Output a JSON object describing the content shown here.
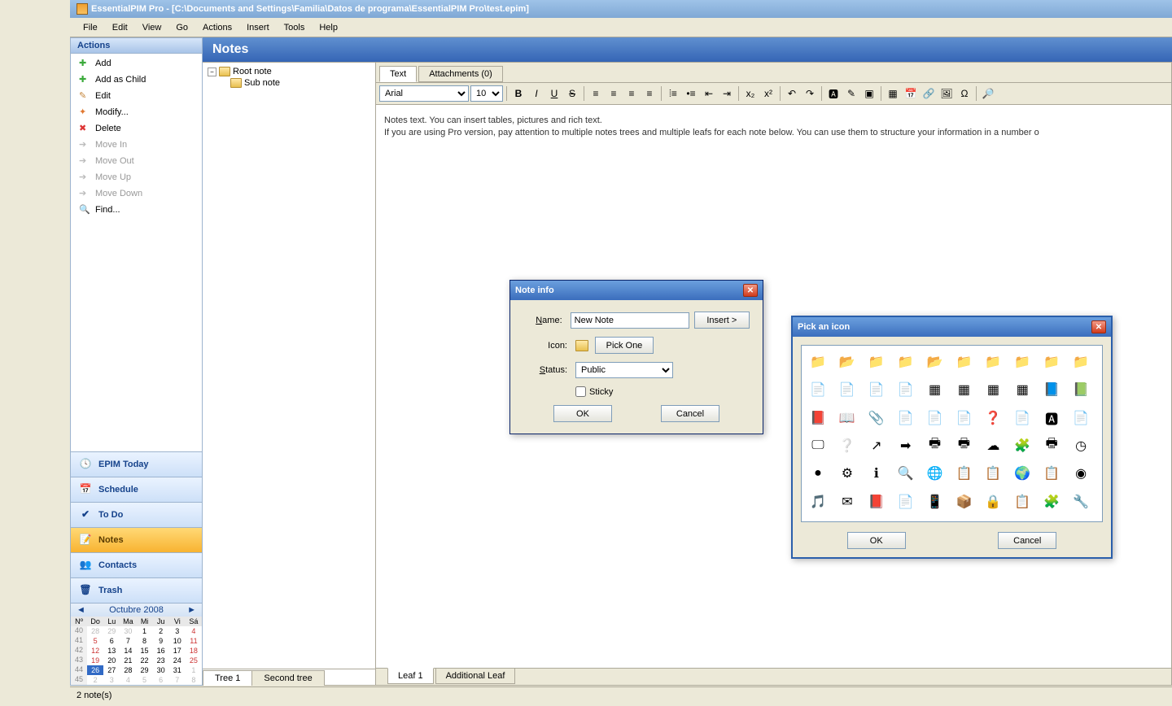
{
  "title": "EssentialPIM Pro - [C:\\Documents and Settings\\Familia\\Datos de programa\\EssentialPIM Pro\\test.epim]",
  "menu": [
    "File",
    "Edit",
    "View",
    "Go",
    "Actions",
    "Insert",
    "Tools",
    "Help"
  ],
  "actions_header": "Actions",
  "actions": [
    {
      "label": "Add",
      "icon": "ic-add-plus",
      "disabled": false
    },
    {
      "label": "Add as Child",
      "icon": "ic-addchild",
      "disabled": false
    },
    {
      "label": "Edit",
      "icon": "ic-edit",
      "disabled": false
    },
    {
      "label": "Modify...",
      "icon": "ic-modify",
      "disabled": false
    },
    {
      "label": "Delete",
      "icon": "ic-delete",
      "disabled": false
    },
    {
      "label": "Move In",
      "icon": "ic-arrow",
      "disabled": true
    },
    {
      "label": "Move Out",
      "icon": "ic-arrow",
      "disabled": true
    },
    {
      "label": "Move Up",
      "icon": "ic-arrow",
      "disabled": true
    },
    {
      "label": "Move Down",
      "icon": "ic-arrow",
      "disabled": true
    },
    {
      "label": "Find...",
      "icon": "ic-find",
      "disabled": false
    }
  ],
  "nav": [
    {
      "label": "EPIM Today",
      "icon": "🕓",
      "active": false
    },
    {
      "label": "Schedule",
      "icon": "📅",
      "active": false
    },
    {
      "label": "To Do",
      "icon": "✔",
      "active": false
    },
    {
      "label": "Notes",
      "icon": "📝",
      "active": true
    },
    {
      "label": "Contacts",
      "icon": "👥",
      "active": false
    },
    {
      "label": "Trash",
      "icon": "🗑",
      "active": false
    }
  ],
  "calendar": {
    "title": "Octubre  2008",
    "days_hdr": [
      "Nº",
      "Do",
      "Lu",
      "Ma",
      "Mi",
      "Ju",
      "Vi",
      "Sá"
    ],
    "rows": [
      [
        "40",
        "28",
        "29",
        "30",
        "1",
        "2",
        "3",
        "4"
      ],
      [
        "41",
        "5",
        "6",
        "7",
        "8",
        "9",
        "10",
        "11"
      ],
      [
        "42",
        "12",
        "13",
        "14",
        "15",
        "16",
        "17",
        "18"
      ],
      [
        "43",
        "19",
        "20",
        "21",
        "22",
        "23",
        "24",
        "25"
      ],
      [
        "44",
        "26",
        "27",
        "28",
        "29",
        "30",
        "31",
        "1"
      ],
      [
        "45",
        "2",
        "3",
        "4",
        "5",
        "6",
        "7",
        "8"
      ]
    ]
  },
  "notes_header": "Notes",
  "tree": {
    "root": "Root note",
    "child": "Sub note",
    "tabs": [
      "Tree 1",
      "Second tree"
    ]
  },
  "content_tabs": {
    "text": "Text",
    "attach": "Attachments (0)"
  },
  "font_name": "Arial",
  "font_size": "10",
  "editor_text": "Notes text. You can insert tables, pictures and rich text.\nIf you are using Pro version, pay attention to multiple notes trees and multiple leafs for each note below. You can use them to structure your information in a number o",
  "leaf_tabs": [
    "Leaf 1",
    "Additional Leaf"
  ],
  "status": "2 note(s)",
  "note_info": {
    "title": "Note info",
    "name_label": "Name:",
    "name_value": "New Note",
    "insert_btn": "Insert >",
    "icon_label": "Icon:",
    "pick_one": "Pick One",
    "status_label": "Status:",
    "status_value": "Public",
    "sticky": "Sticky",
    "ok": "OK",
    "cancel": "Cancel"
  },
  "icon_picker": {
    "title": "Pick an icon",
    "ok": "OK",
    "cancel": "Cancel",
    "icons": [
      "📁",
      "📂",
      "📁",
      "📁",
      "📂",
      "📁",
      "📁",
      "📁",
      "📁",
      "📁",
      "📄",
      "📄",
      "📄",
      "📄",
      "▦",
      "▦",
      "▦",
      "▦",
      "📘",
      "📗",
      "📕",
      "📖",
      "📎",
      "📄",
      "📄",
      "📄",
      "❓",
      "📄",
      "🅰",
      "📄",
      "🖵",
      "❔",
      "↗",
      "➡",
      "🖶",
      "🖶",
      "☁",
      "🧩",
      "🖶",
      "◷",
      "●",
      "⚙",
      "ℹ",
      "🔍",
      "🌐",
      "📋",
      "📋",
      "🌍",
      "📋",
      "◉",
      "🎵",
      "✉",
      "📕",
      "📄",
      "📱",
      "📦",
      "🔒",
      "📋",
      "🧩",
      "🔧"
    ]
  }
}
